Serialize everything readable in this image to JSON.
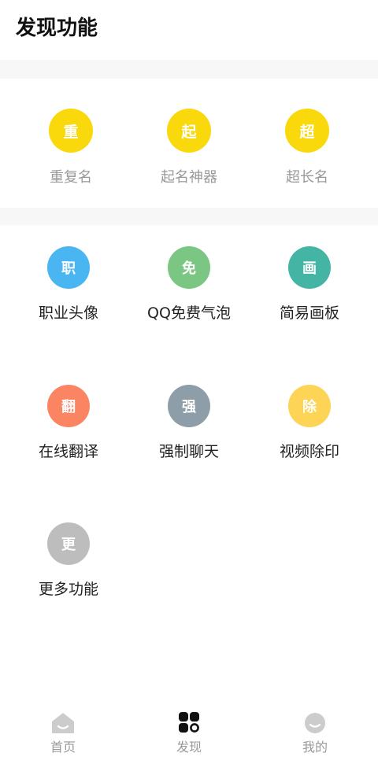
{
  "header": {
    "title": "发现功能"
  },
  "grid_row1": [
    {
      "glyph": "重",
      "label": "重复名",
      "color": "#f9d90b"
    },
    {
      "glyph": "起",
      "label": "起名神器",
      "color": "#f9d90b"
    },
    {
      "glyph": "超",
      "label": "超长名",
      "color": "#f9d90b"
    }
  ],
  "grid_main": [
    {
      "glyph": "职",
      "label": "职业头像",
      "color": "#49b6f1"
    },
    {
      "glyph": "免",
      "label": "QQ免费气泡",
      "color": "#7cc683"
    },
    {
      "glyph": "画",
      "label": "简易画板",
      "color": "#44b5a4"
    },
    {
      "glyph": "翻",
      "label": "在线翻译",
      "color": "#fb8563"
    },
    {
      "glyph": "强",
      "label": "强制聊天",
      "color": "#8e9ea8"
    },
    {
      "glyph": "除",
      "label": "视频除印",
      "color": "#fdd456"
    },
    {
      "glyph": "更",
      "label": "更多功能",
      "color": "#bdbdbd"
    }
  ],
  "tabbar": {
    "tabs": [
      {
        "label": "首页",
        "icon": "home-icon",
        "active": false
      },
      {
        "label": "发现",
        "icon": "discover-grid-icon",
        "active": true
      },
      {
        "label": "我的",
        "icon": "smiley-profile-icon",
        "active": false
      }
    ]
  },
  "colors": {
    "icon_inactive": "#cccccc",
    "icon_active": "#111111",
    "divider": "#f7f7f7"
  }
}
